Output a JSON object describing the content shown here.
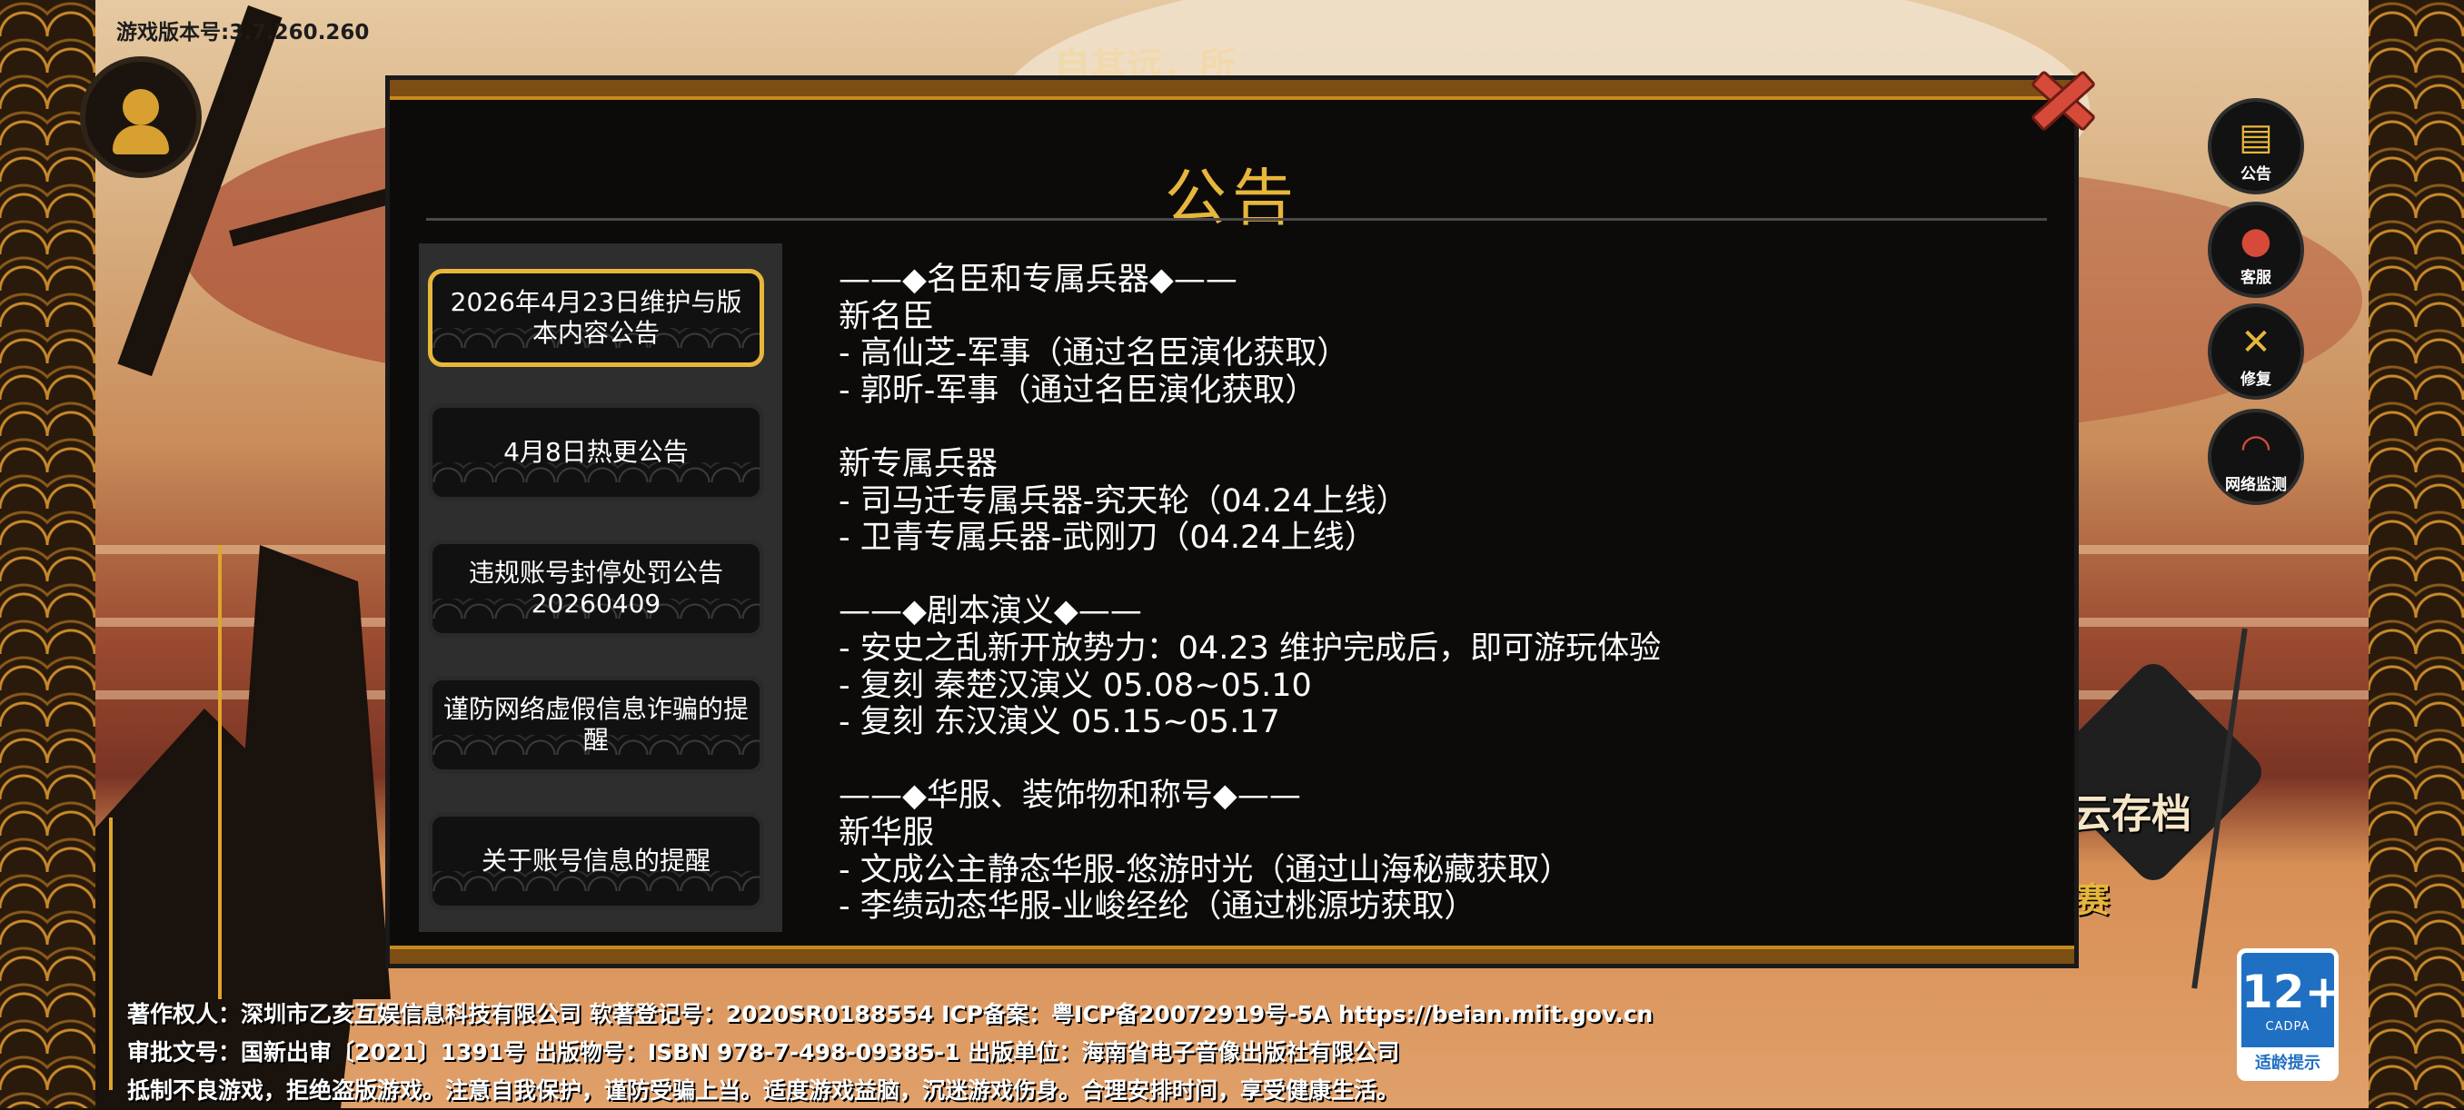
{
  "version": "游戏版本号:3.7.260.260",
  "background_title": "自其远，所",
  "modal": {
    "title": "公告",
    "tabs": [
      {
        "label": "2026年4月23日维护与版本内容公告",
        "active": true
      },
      {
        "label": "4月8日热更公告",
        "active": false
      },
      {
        "label": "违规账号封停处罚公告20260409",
        "active": false
      },
      {
        "label": "谨防网络虚假信息诈骗的提醒",
        "active": false
      },
      {
        "label": "关于账号信息的提醒",
        "active": false
      }
    ],
    "content_lines": [
      "——◆名臣和专属兵器◆——",
      "新名臣",
      "- 高仙芝-军事（通过名臣演化获取）",
      "- 郭昕-军事（通过名臣演化获取）",
      "",
      "新专属兵器",
      "- 司马迁专属兵器-究天轮（04.24上线）",
      "- 卫青专属兵器-武刚刀（04.24上线）",
      "",
      "——◆剧本演义◆——",
      "- 安史之乱新开放势力：04.23 维护完成后，即可游玩体验",
      "- 复刻 秦楚汉演义 05.08~05.10",
      "- 复刻 东汉演义 05.15~05.17",
      "",
      "——◆华服、装饰物和称号◆——",
      "新华服",
      "- 文成公主静态华服-悠游时光（通过山海秘藏获取）",
      "- 李绩动态华服-业峻经纶（通过桃源坊获取）"
    ]
  },
  "right_buttons": [
    {
      "label": "公告",
      "icon": "scroll-icon"
    },
    {
      "label": "客服",
      "icon": "headset-icon"
    },
    {
      "label": "修复",
      "icon": "wrench-icon"
    },
    {
      "label": "网络监测",
      "icon": "wifi-icon"
    }
  ],
  "save_text": "云存档",
  "save_text2": "赛",
  "age_rating": {
    "age": "12+",
    "org": "CADPA",
    "tip": "适龄提示"
  },
  "footer": [
    "著作权人：深圳市乙亥互娱信息科技有限公司 软著登记号：2020SR0188554   ICP备案：粤ICP备20072919号-5A https://beian.miit.gov.cn",
    "审批文号：国新出审〔2021〕1391号   出版物号：ISBN 978-7-498-09385-1   出版单位：海南省电子音像出版社有限公司",
    "抵制不良游戏，拒绝盗版游戏。注意自我保护，谨防受骗上当。适度游戏益脑，沉迷游戏伤身。合理安排时间，享受健康生活。"
  ],
  "colors": {
    "accent": "#e7b63b",
    "modal_bg": "#0c0b0a",
    "close": "#d64a3a",
    "age_badge": "#1f6fc2"
  }
}
